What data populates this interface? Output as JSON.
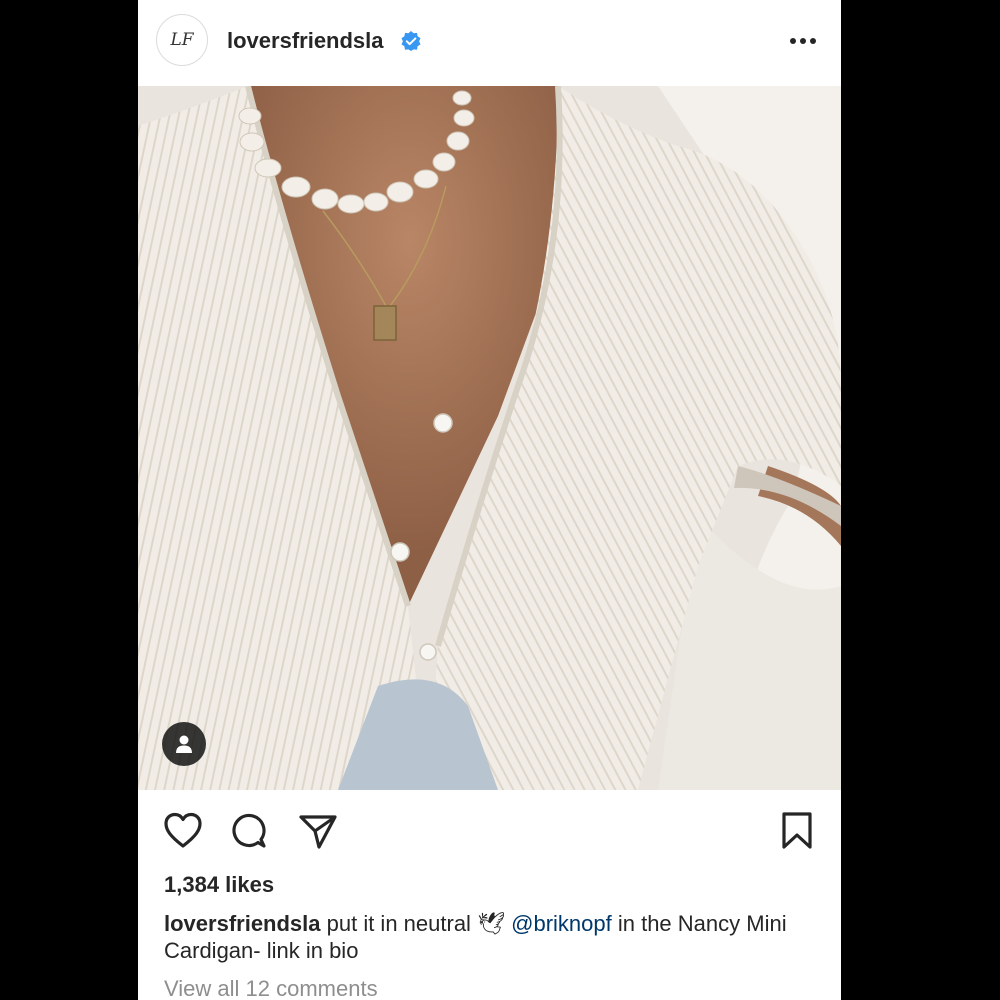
{
  "header": {
    "avatar_text": "LF",
    "username": "loversfriendsla",
    "verified_icon": "verified-badge-icon",
    "more_icon": "more-options-icon"
  },
  "photo": {
    "description_icon": "user-tag-icon"
  },
  "actions": {
    "like_icon": "heart-icon",
    "comment_icon": "comment-icon",
    "share_icon": "share-icon",
    "save_icon": "bookmark-icon"
  },
  "likes": "1,384 likes",
  "caption": {
    "username": "loversfriendsla",
    "text_before": " put it in neutral ",
    "emoji": "🕊",
    "mention": "@briknopf",
    "text_after": " in the Nancy Mini Cardigan- link in bio"
  },
  "comments_link": "View all 12 comments",
  "colors": {
    "verified_blue": "#3897f0",
    "text": "#262626",
    "secondary_text": "#8e8e8e",
    "mention": "#00376b"
  }
}
